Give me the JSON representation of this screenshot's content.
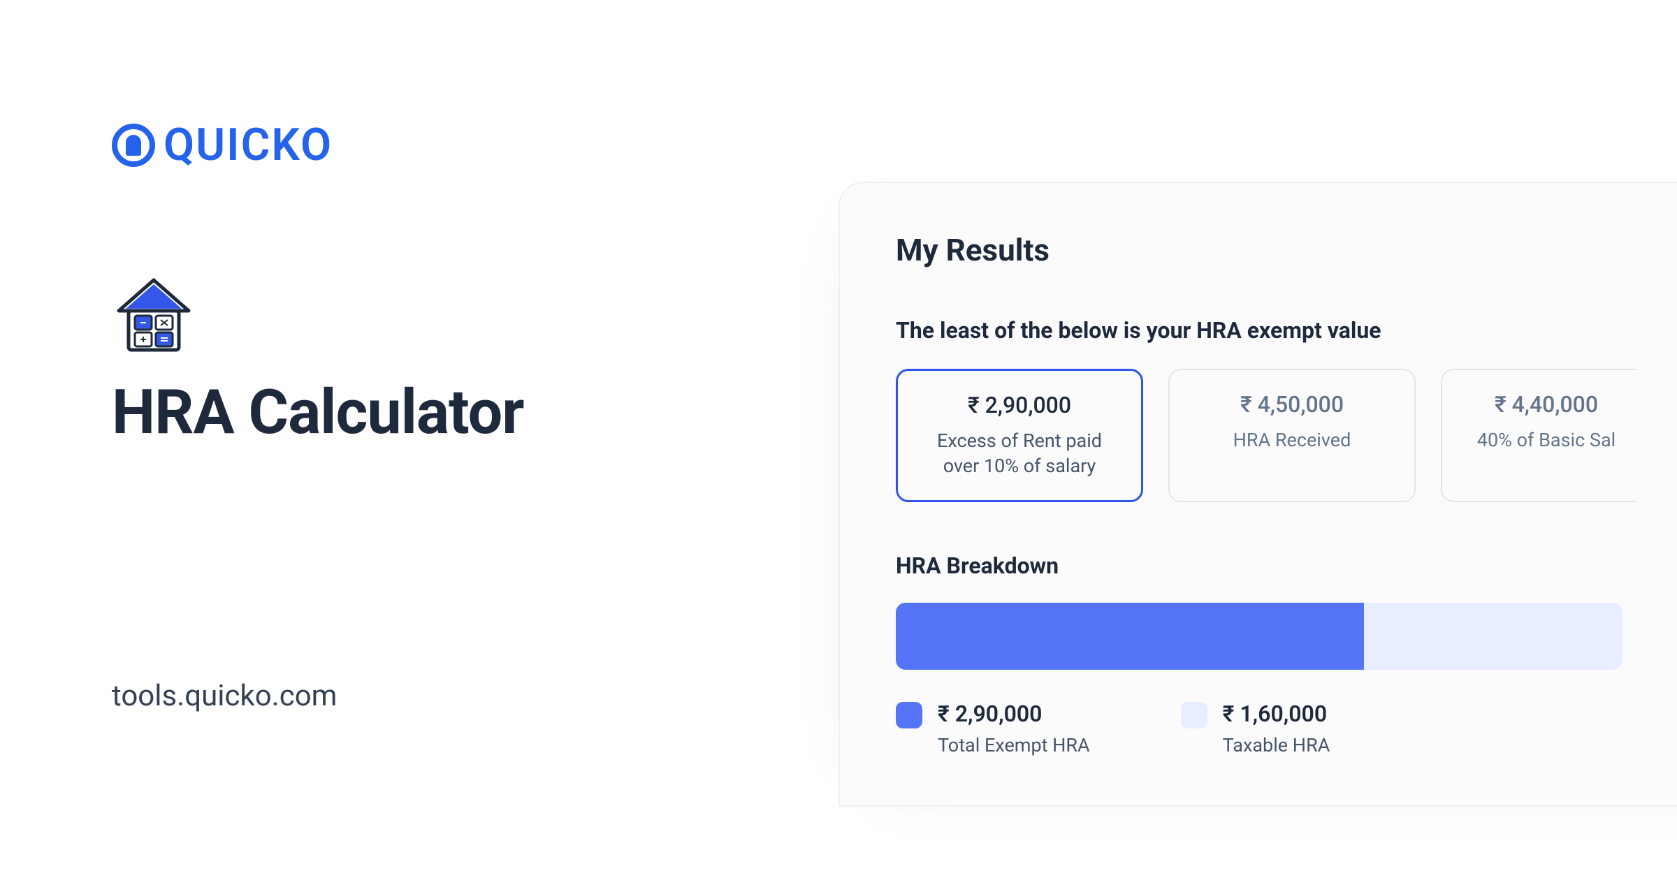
{
  "brand": {
    "name": "QUICKO"
  },
  "left": {
    "title": "HRA Calculator",
    "url": "tools.quicko.com"
  },
  "results": {
    "heading": "My Results",
    "subhead": "The least of the below is your HRA exempt value",
    "tiles": [
      {
        "amount": "₹ 2,90,000",
        "label_l1": "Excess of Rent paid",
        "label_l2": "over 10% of salary"
      },
      {
        "amount": "₹ 4,50,000",
        "label_l1": "HRA Received",
        "label_l2": ""
      },
      {
        "amount": "₹ 4,40,000",
        "label_l1": "40% of Basic Sal",
        "label_l2": ""
      }
    ],
    "breakdown_heading": "HRA Breakdown",
    "legend": [
      {
        "value": "₹ 2,90,000",
        "name": "Total Exempt HRA"
      },
      {
        "value": "₹ 1,60,000",
        "name": "Taxable HRA"
      }
    ]
  },
  "chart_data": {
    "type": "bar",
    "title": "HRA Breakdown",
    "categories": [
      "Total Exempt HRA",
      "Taxable HRA"
    ],
    "values": [
      290000,
      160000
    ],
    "ylabel": "₹",
    "ylim": [
      0,
      450000
    ]
  }
}
